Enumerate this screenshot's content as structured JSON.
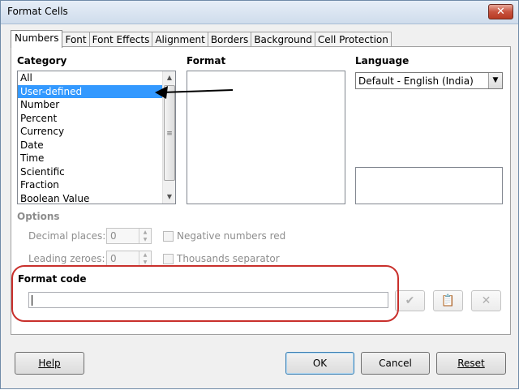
{
  "window": {
    "title": "Format Cells",
    "close_glyph": "✕"
  },
  "tabs": [
    "Numbers",
    "Font",
    "Font Effects",
    "Alignment",
    "Borders",
    "Background",
    "Cell Protection"
  ],
  "category": {
    "label": "Category",
    "items": [
      "All",
      "User-defined",
      "Number",
      "Percent",
      "Currency",
      "Date",
      "Time",
      "Scientific",
      "Fraction",
      "Boolean Value"
    ],
    "selected": "User-defined"
  },
  "format": {
    "label": "Format"
  },
  "language": {
    "label": "Language",
    "selected": "Default - English (India)"
  },
  "options": {
    "label": "Options",
    "decimal_places_label": "Decimal places:",
    "decimal_places_value": "0",
    "leading_zeroes_label": "Leading zeroes:",
    "leading_zeroes_value": "0",
    "negative_red_label": "Negative numbers red",
    "thousands_label": "Thousands separator"
  },
  "format_code": {
    "label": "Format code",
    "value": ""
  },
  "buttons": {
    "help": "Help",
    "ok": "OK",
    "cancel": "Cancel",
    "reset": "Reset"
  },
  "icons": {
    "apply": "check-icon",
    "edit_comment": "clipboard-icon",
    "delete": "x-icon"
  }
}
